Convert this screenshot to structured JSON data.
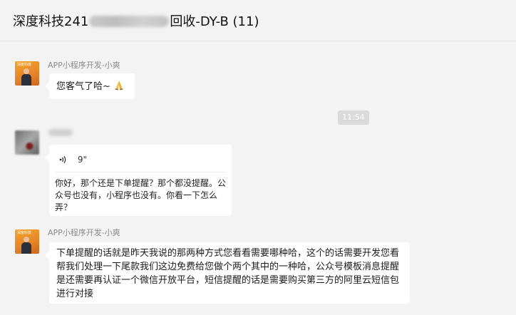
{
  "window": {
    "title_prefix": "深度科技241",
    "title_suffix": "回收-DY-B (11)"
  },
  "messages": [
    {
      "sender": "APP小程序开发-小爽",
      "avatar_text": "深度科技",
      "text": "您客气了哈~",
      "emoji": "folded-hands-icon"
    },
    {
      "timestamp": "11:54"
    },
    {
      "voice_duration": "9\"",
      "voice_icon": "voice-wave-icon",
      "transcript": "你好，那个还是下单提醒？那个都没提醒。公众号也没有，小程序也没有。你看一下怎么弄？"
    },
    {
      "sender": "APP小程序开发-小爽",
      "avatar_text": "深度科技",
      "text": "下单提醒的话就是昨天我说的那两种方式您看看需要哪种哈，这个的话需要开发您看帮我们处理一下尾款我们这边免费给您做个两个其中的一种哈，公众号模板消息提醒是还需要再认证一个微信开放平台，短信提醒的话是需要购买第三方的阿里云短信包进行对接"
    }
  ],
  "colors": {
    "background": "#f3f3f3",
    "bubble": "#ffffff",
    "timestamp_bg": "#dadada",
    "sender_text": "#8a8a8a"
  }
}
